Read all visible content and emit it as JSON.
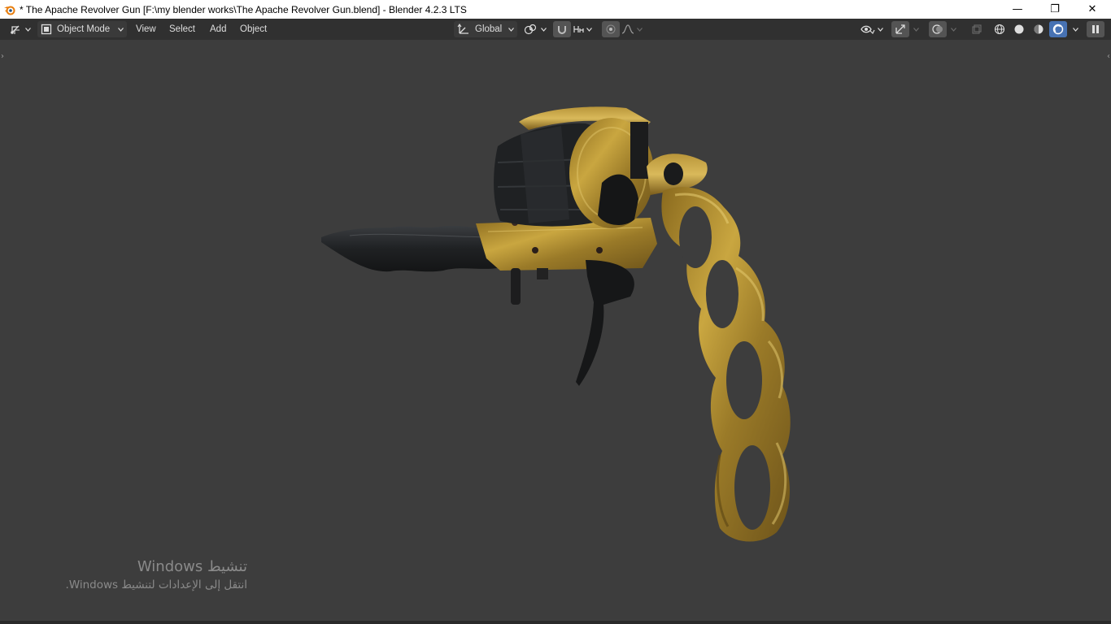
{
  "window": {
    "title": "* The Apache Revolver Gun [F:\\my blender works\\The Apache Revolver Gun.blend] - Blender 4.2.3 LTS",
    "app_icon": "blender-logo-icon",
    "controls": {
      "minimize": "—",
      "restore": "❐",
      "close": "✕"
    }
  },
  "header": {
    "editor_type_icon": "3d-viewport-icon",
    "mode": "Object Mode",
    "menus": [
      "View",
      "Select",
      "Add",
      "Object"
    ],
    "transform_orientation": "Global",
    "icons": {
      "orientation": "transform-orientation-icon",
      "pivot": "pivot-point-icon",
      "snap": "snap-magnet-icon",
      "snap_target": "snap-increment-icon",
      "proportional": "proportional-editing-icon",
      "falloff": "falloff-curve-icon",
      "visibility": "object-visibility-icon",
      "gizmo": "gizmo-icon",
      "overlay": "overlay-icon",
      "xray": "xray-icon",
      "wireframe": "wireframe-shading-icon",
      "solid": "solid-shading-icon",
      "material": "material-preview-icon",
      "rendered": "rendered-shading-icon",
      "pause": "pause-render-icon"
    },
    "colors": {
      "active_blue": "#4772b3",
      "header_bg": "#303030"
    }
  },
  "viewport": {
    "background": "#3d3d3d",
    "object": "Apache revolver with brass knuckle grip and folding knife",
    "activation_watermark": {
      "line1": "تنشيط Windows",
      "line2": "انتقل إلى الإعدادات لتنشيط Windows."
    }
  }
}
